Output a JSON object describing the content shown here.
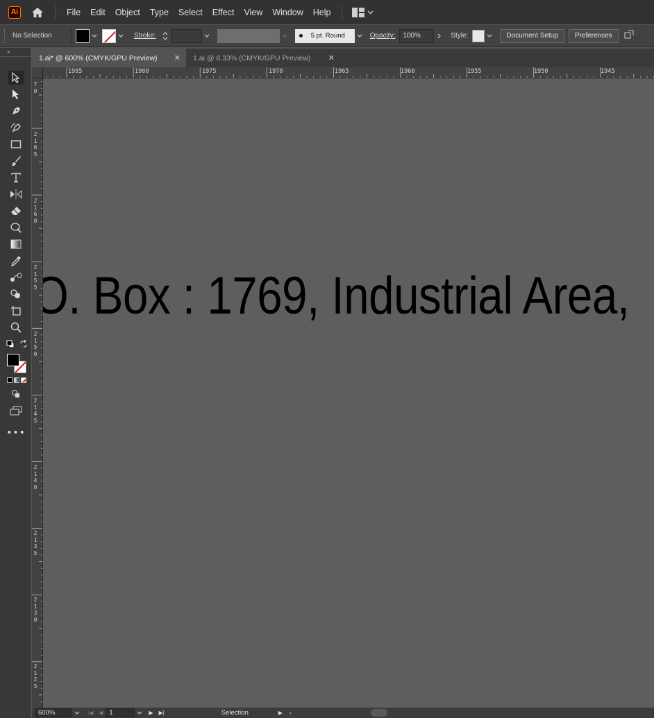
{
  "app": {
    "logo_text": "Ai"
  },
  "menu": {
    "items": [
      "File",
      "Edit",
      "Object",
      "Type",
      "Select",
      "Effect",
      "View",
      "Window",
      "Help"
    ]
  },
  "control_bar": {
    "selection_status": "No Selection",
    "stroke_label": "Stroke:",
    "brush_label": "5 pt. Round",
    "opacity_label": "Opacity:",
    "opacity_value": "100%",
    "style_label": "Style:",
    "document_setup_label": "Document Setup",
    "preferences_label": "Preferences"
  },
  "tabs": [
    {
      "label": "1.ai* @ 600% (CMYK/GPU Preview)",
      "active": true
    },
    {
      "label": "1.ai @ 8.33% (CMYK/GPU Preview)",
      "active": false
    }
  ],
  "ruler": {
    "top": [
      "1985",
      "1980",
      "1975",
      "1970",
      "1965",
      "1960",
      "1955",
      "1950",
      "1945"
    ],
    "left": [
      "70",
      "2165",
      "2160",
      "2155",
      "2150",
      "2145",
      "2140",
      "2135",
      "2130",
      "2125"
    ]
  },
  "canvas": {
    "text": "O. Box : 1769, Industrial Area,",
    "text_color": "#000000",
    "background": "#5e5e5e"
  },
  "status_bar": {
    "zoom": "600%",
    "artboard": "1",
    "mode": "Selection"
  },
  "colors": {
    "menubar_bg": "#323232",
    "panel_bg": "#424242",
    "accent_logo": "#ff9a00",
    "none_stroke": "#e0141e"
  }
}
